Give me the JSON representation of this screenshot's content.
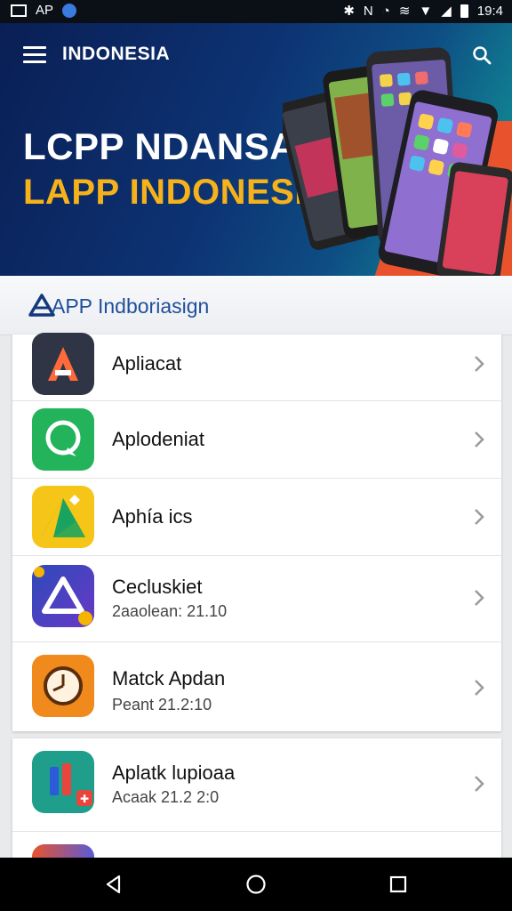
{
  "status_bar": {
    "left_text": "AP",
    "time": "19:4"
  },
  "header": {
    "brand": "INDONESIA"
  },
  "banner": {
    "line1": "LCPP NDANSA",
    "line2": "LAPP INDONESIA"
  },
  "subheader": {
    "title": "APP Indboriasign"
  },
  "apps": [
    {
      "title": "Apliacat",
      "subtitle": "",
      "icon": "a-letter-icon"
    },
    {
      "title": "Aplodeniat",
      "subtitle": "",
      "icon": "chat-bubble-icon"
    },
    {
      "title": "Aphía ics",
      "subtitle": "",
      "icon": "drive-triangle-icon"
    },
    {
      "title": "Cecluskiet",
      "subtitle": "2aaolean: 21.10",
      "icon": "triangle-app-icon"
    },
    {
      "title": "Matck Apdan",
      "subtitle": "Peant 21.2:10",
      "icon": "clock-icon"
    },
    {
      "title": "Aplatk lupioaa",
      "subtitle": "Acaak 21.2 2:0",
      "icon": "music-app-icon"
    },
    {
      "title": "",
      "subtitle": "",
      "icon": "partial-app-icon"
    }
  ],
  "colors": {
    "accent": "#f6b21a",
    "banner_dark": "#0a1f55",
    "subheader_text": "#1f4f9a"
  }
}
